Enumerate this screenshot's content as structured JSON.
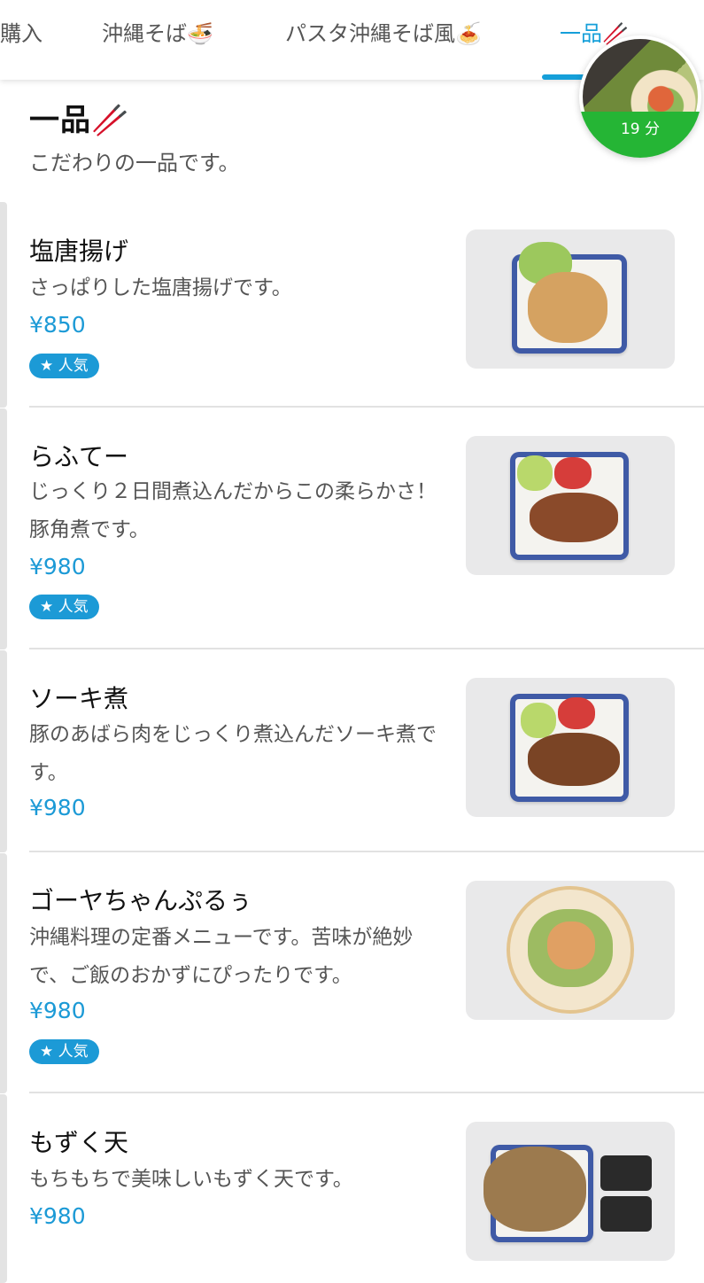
{
  "tabs": [
    {
      "label": "購入",
      "emoji": ""
    },
    {
      "label": "沖縄そば",
      "emoji": "🍜"
    },
    {
      "label": "パスタ沖縄そば風",
      "emoji": "🍝"
    },
    {
      "label": "一品",
      "emoji": "🥢"
    }
  ],
  "active_tab": "一品",
  "timer": {
    "label": "19 分"
  },
  "section": {
    "title": "一品",
    "title_emoji": "🥢",
    "subtitle": "こだわりの一品です。"
  },
  "items": [
    {
      "name": "塩唐揚げ",
      "desc": "さっぱりした塩唐揚げです。",
      "price": "¥850",
      "badge": "★ 人気"
    },
    {
      "name": "らふてー",
      "desc": "じっくり２日間煮込んだからこの柔らかさ！豚角煮です。",
      "price": "¥980",
      "badge": "★ 人気"
    },
    {
      "name": "ソーキ煮",
      "desc": "豚のあばら肉をじっくり煮込んだソーキ煮です。",
      "price": "¥980",
      "badge": ""
    },
    {
      "name": "ゴーヤちゃんぷるぅ",
      "desc": "沖縄料理の定番メニューです。苦味が絶妙で、ご飯のおかずにぴったりです。",
      "price": "¥980",
      "badge": "★ 人気"
    },
    {
      "name": "もずく天",
      "desc": "もちもちで美味しいもずく天です。",
      "price": "¥980",
      "badge": ""
    }
  ],
  "colors": {
    "accent": "#1c9ad6",
    "timer_green": "#25b535"
  }
}
